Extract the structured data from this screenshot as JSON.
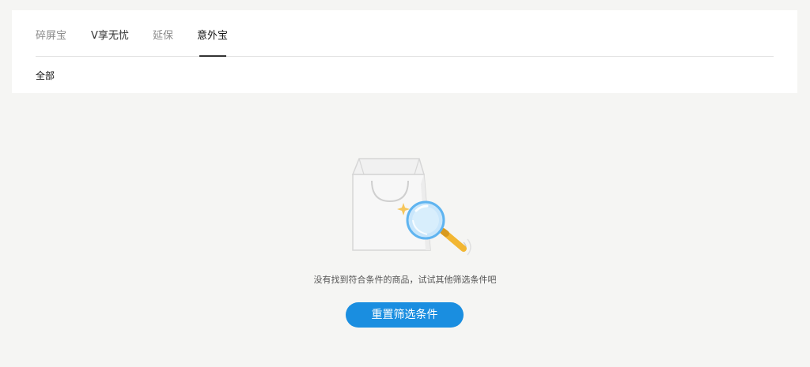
{
  "tabs": [
    {
      "label": "碎屏宝",
      "active": false
    },
    {
      "label": "V享无忧",
      "active": false
    },
    {
      "label": "延保",
      "active": false
    },
    {
      "label": "意外宝",
      "active": true
    }
  ],
  "filters": {
    "selected": "全部"
  },
  "empty_state": {
    "message": "没有找到符合条件的商品，试试其他筛选条件吧",
    "reset_label": "重置筛选条件",
    "illustration_icon": "shopping-bag-magnifier-icon"
  },
  "colors": {
    "accent": "#1a8ee0",
    "background": "#f5f5f3",
    "panel": "#ffffff"
  }
}
